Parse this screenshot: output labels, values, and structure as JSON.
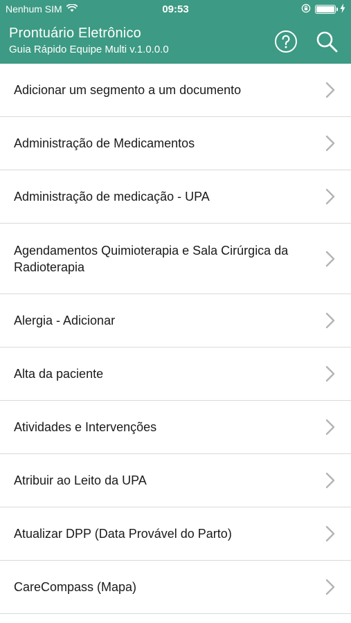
{
  "status_bar": {
    "carrier": "Nenhum SIM",
    "time": "09:53",
    "battery_level": 1.0,
    "icons": [
      "wifi-icon",
      "orientation-lock-icon",
      "battery-icon",
      "charging-icon"
    ]
  },
  "header": {
    "title": "Prontuário Eletrônico",
    "subtitle": "Guia Rápido Equipe Multi v.1.0.0.0",
    "icons": [
      "help-icon",
      "search-icon"
    ]
  },
  "list": {
    "items": [
      {
        "label": "Adicionar um segmento a um documento"
      },
      {
        "label": "Administração de Medicamentos"
      },
      {
        "label": "Administração de medicação - UPA"
      },
      {
        "label": "Agendamentos Quimioterapia e Sala Cirúrgica da Radioterapia"
      },
      {
        "label": "Alergia - Adicionar"
      },
      {
        "label": "Alta da paciente"
      },
      {
        "label": "Atividades e Intervenções"
      },
      {
        "label": "Atribuir ao Leito da UPA"
      },
      {
        "label": "Atualizar DPP (Data Provável do Parto)"
      },
      {
        "label": "CareCompass (Mapa)"
      }
    ]
  },
  "colors": {
    "header_bg": "#3d9a84",
    "header_text": "#ffffff",
    "item_text": "#1a1a1a",
    "chevron": "#b3b3b3",
    "divider": "#d9d9d9"
  }
}
